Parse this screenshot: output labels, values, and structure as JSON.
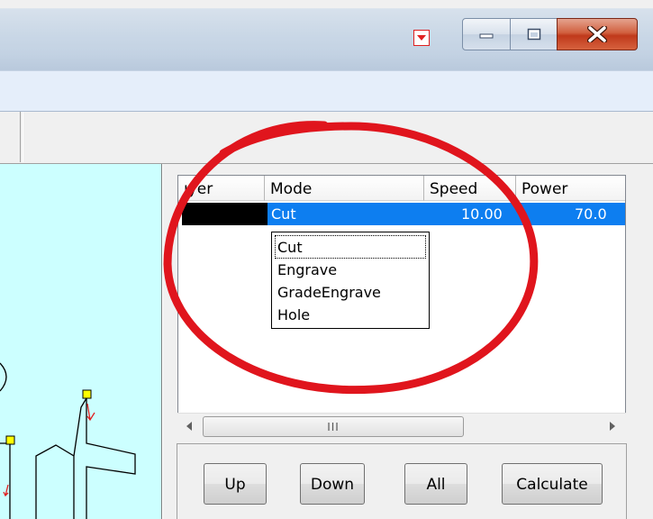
{
  "window": {
    "controls": {
      "minimize": "minimize-icon",
      "maximize": "maximize-icon",
      "close": "close-icon"
    }
  },
  "grid": {
    "columns": [
      "ıyer",
      "Mode",
      "Speed",
      "Power"
    ],
    "selected_row": {
      "layer_color": "#000000",
      "mode": "Cut",
      "speed": "10.00",
      "power": "70.0"
    },
    "mode_options": [
      "Cut",
      "Engrave",
      "GradeEngrave",
      "Hole"
    ],
    "scroll_grip": "III"
  },
  "buttons": {
    "up": "Up",
    "down": "Down",
    "all": "All",
    "calculate": "Calculate"
  },
  "colors": {
    "selection": "#0d7ef0",
    "highlight_circle": "#e0151d",
    "canvas_bg": "#ccffff"
  }
}
